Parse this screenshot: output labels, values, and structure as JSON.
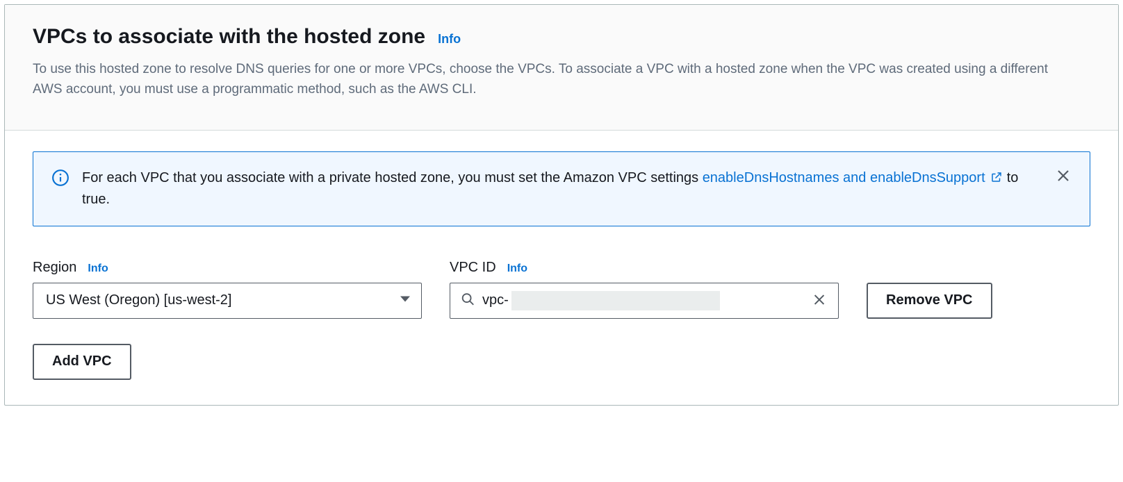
{
  "header": {
    "title": "VPCs to associate with the hosted zone",
    "info_label": "Info",
    "description": "To use this hosted zone to resolve DNS queries for one or more VPCs, choose the VPCs. To associate a VPC with a hosted zone when the VPC was created using a different AWS account, you must use a programmatic method, such as the AWS CLI."
  },
  "alert": {
    "text_before_link": "For each VPC that you associate with a private hosted zone, you must set the Amazon VPC settings ",
    "link_text": "enableDnsHostnames and enableDnsSupport",
    "text_after_link": " to true."
  },
  "fields": {
    "region": {
      "label": "Region",
      "info_label": "Info",
      "value": "US West (Oregon) [us-west-2]"
    },
    "vpc_id": {
      "label": "VPC ID",
      "info_label": "Info",
      "value_prefix": "vpc-"
    }
  },
  "buttons": {
    "remove_vpc": "Remove VPC",
    "add_vpc": "Add VPC"
  }
}
